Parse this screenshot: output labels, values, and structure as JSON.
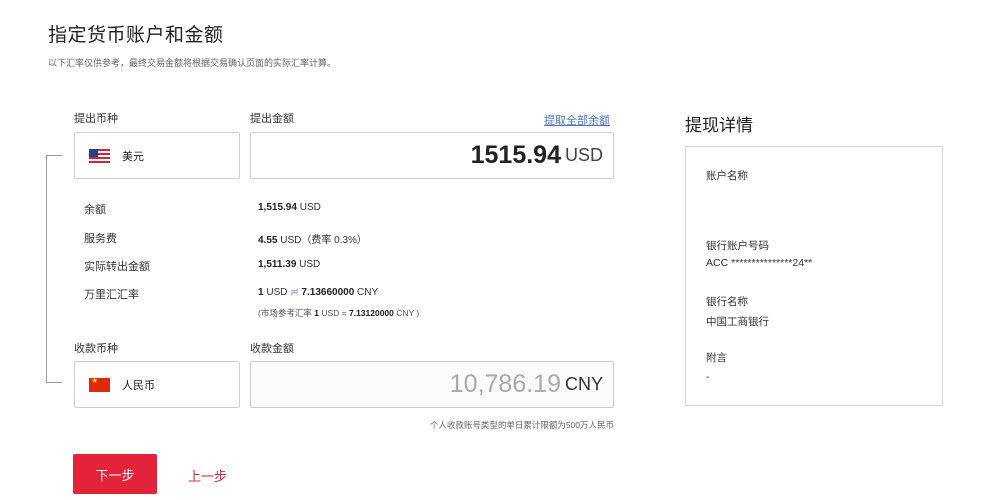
{
  "header": {
    "title": "指定货币账户和金额",
    "subtitle": "以下汇率仅供参考，最终交易金额将根据交易确认页面的实际汇率计算。"
  },
  "withdraw": {
    "currency_label": "提出币种",
    "amount_label": "提出金额",
    "withdraw_all_link": "提取全部余额",
    "currency_name": "美元",
    "flag_icon": "us-flag-icon",
    "amount_value": "1515.94",
    "amount_currency": "USD"
  },
  "details": {
    "balance_label": "余额",
    "balance_value": "1,515.94",
    "balance_unit": "USD",
    "fee_label": "服务费",
    "fee_value": "4.55",
    "fee_unit": "USD（费率 0.3%）",
    "actual_label": "实际转出金额",
    "actual_value": "1,511.39",
    "actual_unit": "USD",
    "rate_label": "万里汇汇率",
    "rate_from": "1",
    "rate_from_unit": "USD",
    "rate_symbol": "≓",
    "rate_to": "7.13660000",
    "rate_to_unit": "CNY",
    "market_prefix": "(市场参考汇率",
    "market_from": "1",
    "market_mid": "USD =",
    "market_to": "7.13120000",
    "market_suffix": "CNY )"
  },
  "receive": {
    "currency_label": "收款币种",
    "amount_label": "收款金额",
    "currency_name": "人民币",
    "flag_icon": "cn-flag-icon",
    "amount_value": "10,786.19",
    "amount_currency": "CNY",
    "limit_note": "个人收款账号类型的单日累计限额为500万人民币"
  },
  "actions": {
    "next_label": "下一步",
    "prev_label": "上一步"
  },
  "panel": {
    "title": "提现详情",
    "account_name_label": "账户名称",
    "account_name_value": "",
    "account_number_label": "银行账户号码",
    "account_number_value": "ACC ***************24**",
    "bank_name_label": "银行名称",
    "bank_name_value": "中国工商银行",
    "remark_label": "附言",
    "remark_value": "-"
  },
  "colors": {
    "primary": "#e2233a",
    "link": "#4a73c9"
  }
}
